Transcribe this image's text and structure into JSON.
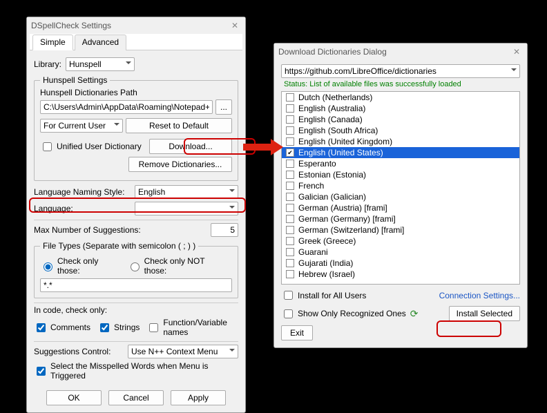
{
  "settings": {
    "title": "DSpellCheck Settings",
    "tabs": {
      "simple": "Simple",
      "advanced": "Advanced"
    },
    "library_lbl": "Library:",
    "library_val": "Hunspell",
    "hunspell_legend": "Hunspell Settings",
    "dict_path_lbl": "Hunspell Dictionaries Path",
    "dict_path_val": "C:\\Users\\Admin\\AppData\\Roaming\\Notepad++",
    "browse_btn": "...",
    "for_user": "For Current User",
    "reset_btn": "Reset to Default",
    "unified_lbl": "Unified User Dictionary",
    "download_btn": "Download...",
    "remove_btn": "Remove Dictionaries...",
    "lang_style_lbl": "Language Naming Style:",
    "lang_style_val": "English",
    "language_lbl": "Language:",
    "language_val": "",
    "max_sugg_lbl": "Max Number of Suggestions:",
    "max_sugg_val": "5",
    "ft_legend": "File Types (Separate with semicolon ( ; ) )",
    "ft_only": "Check only those:",
    "ft_not": "Check only NOT those:",
    "ft_val": "*.*",
    "code_lbl": "In code, check only:",
    "comments": "Comments",
    "strings": "Strings",
    "funcvar": "Function/Variable names",
    "sugg_ctrl_lbl": "Suggestions Control:",
    "sugg_ctrl_val": "Use N++ Context Menu",
    "select_missp": "Select the Misspelled Words when Menu is Triggered",
    "ok": "OK",
    "cancel": "Cancel",
    "apply": "Apply"
  },
  "download": {
    "title": "Download Dictionaries Dialog",
    "url": "https://github.com/LibreOffice/dictionaries",
    "status": "Status: List of available files was successfully loaded",
    "items": [
      {
        "label": "Dutch (Netherlands)",
        "checked": false,
        "selected": false
      },
      {
        "label": "English (Australia)",
        "checked": false,
        "selected": false
      },
      {
        "label": "English (Canada)",
        "checked": false,
        "selected": false
      },
      {
        "label": "English (South Africa)",
        "checked": false,
        "selected": false
      },
      {
        "label": "English (United Kingdom)",
        "checked": false,
        "selected": false
      },
      {
        "label": "English (United States)",
        "checked": true,
        "selected": true
      },
      {
        "label": "Esperanto",
        "checked": false,
        "selected": false
      },
      {
        "label": "Estonian (Estonia)",
        "checked": false,
        "selected": false
      },
      {
        "label": "French",
        "checked": false,
        "selected": false
      },
      {
        "label": "Galician (Galician)",
        "checked": false,
        "selected": false
      },
      {
        "label": "German (Austria) [frami]",
        "checked": false,
        "selected": false
      },
      {
        "label": "German (Germany) [frami]",
        "checked": false,
        "selected": false
      },
      {
        "label": "German (Switzerland) [frami]",
        "checked": false,
        "selected": false
      },
      {
        "label": "Greek (Greece)",
        "checked": false,
        "selected": false
      },
      {
        "label": "Guarani",
        "checked": false,
        "selected": false
      },
      {
        "label": "Gujarati (India)",
        "checked": false,
        "selected": false
      },
      {
        "label": "Hebrew (Israel)",
        "checked": false,
        "selected": false
      }
    ],
    "install_all": "Install for All Users",
    "conn_settings": "Connection Settings...",
    "show_only": "Show Only Recognized Ones",
    "install_sel": "Install Selected",
    "exit": "Exit"
  }
}
